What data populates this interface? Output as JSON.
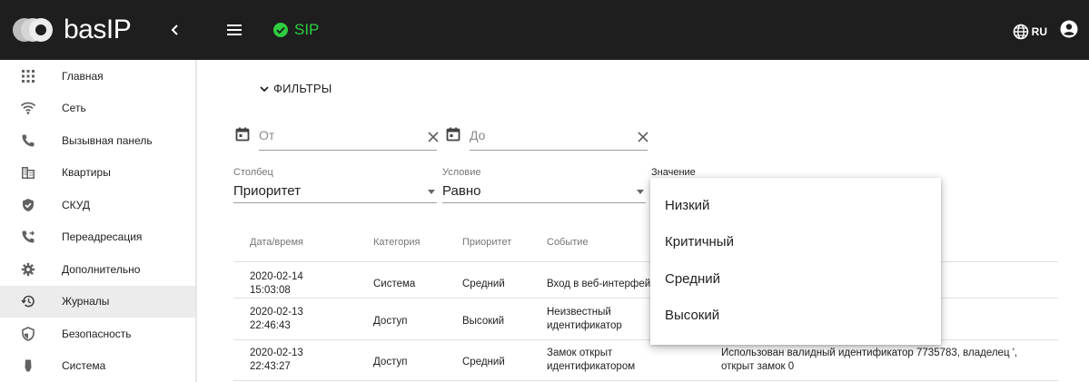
{
  "header": {
    "logo_text": "basIP",
    "sip_label": "SIP",
    "language": "RU",
    "colors": {
      "bar": "#1e1e1e",
      "sip_status": "#2ecc40"
    },
    "icons": [
      "collapse-sidebar-icon",
      "hamburger-menu-icon",
      "check-circle-icon",
      "globe-icon",
      "account-icon"
    ]
  },
  "sidebar": {
    "items": [
      {
        "label": "Главная",
        "icon": "grid-icon"
      },
      {
        "label": "Сеть",
        "icon": "wifi-icon"
      },
      {
        "label": "Вызывная панель",
        "icon": "phone-icon"
      },
      {
        "label": "Квартиры",
        "icon": "building-icon"
      },
      {
        "label": "СКУД",
        "icon": "shield-check-icon"
      },
      {
        "label": "Переадресация",
        "icon": "phone-forward-icon"
      },
      {
        "label": "Дополнительно",
        "icon": "gear-icon"
      },
      {
        "label": "Журналы",
        "icon": "history-icon",
        "active": true
      },
      {
        "label": "Безопасность",
        "icon": "security-icon"
      },
      {
        "label": "Система",
        "icon": "device-icon"
      }
    ]
  },
  "filters": {
    "toggle_label": "ФИЛЬТРЫ",
    "date_from_placeholder": "От",
    "date_to_placeholder": "До",
    "column_label": "Столбец",
    "column_value": "Приоритет",
    "condition_label": "Условие",
    "condition_value": "Равно",
    "value_label": "Значение"
  },
  "table": {
    "headers": [
      "Дата/время",
      "Категория",
      "Приоритет",
      "Событие"
    ],
    "rows": [
      {
        "date": "2020-02-14",
        "time": "15:03:08",
        "category": "Система",
        "priority": "Средний",
        "event": "Вход в веб-интерфейс",
        "details": ""
      },
      {
        "date": "2020-02-13",
        "time": "22:46:43",
        "category": "Доступ",
        "priority": "Высокий",
        "event_l1": "Неизвестный",
        "event_l2": "идентификатор",
        "details": ""
      },
      {
        "date": "2020-02-13",
        "time": "22:43:27",
        "category": "Доступ",
        "priority": "Средний",
        "event_l1": "Замок открыт",
        "event_l2": "идентификатором",
        "details_l1": "Использован валидный идентификатор 7735783, владелец ',",
        "details_l2": "открыт замок 0"
      }
    ]
  },
  "value_dropdown": {
    "options": [
      "Низкий",
      "Критичный",
      "Средний",
      "Высокий"
    ]
  }
}
